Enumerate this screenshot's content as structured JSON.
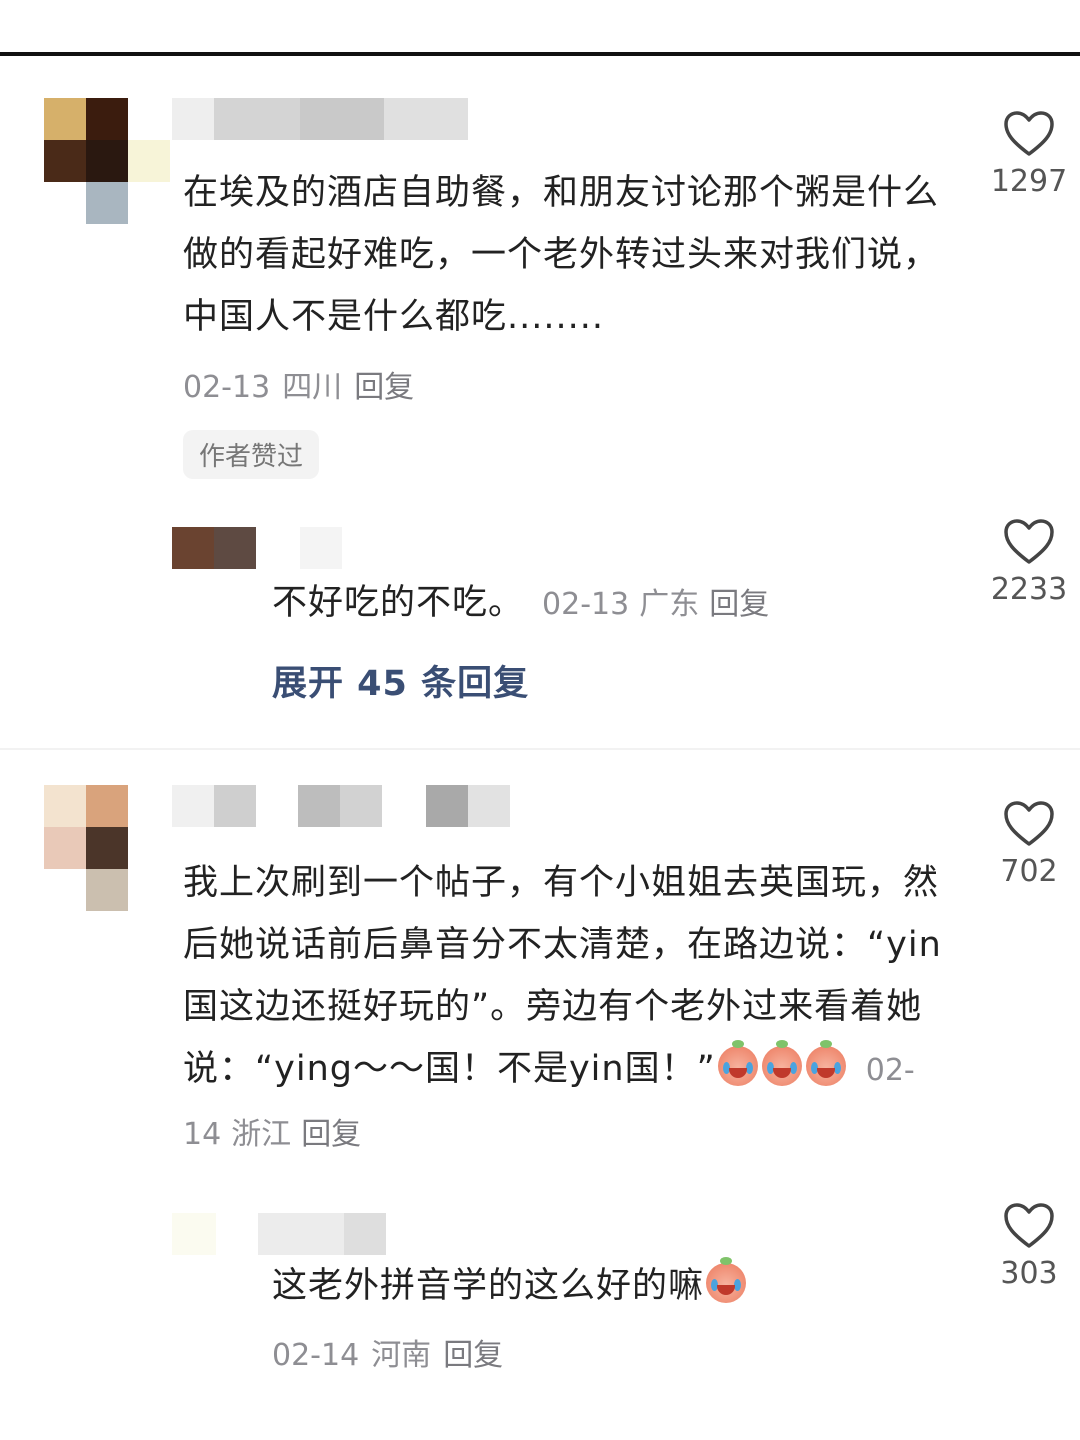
{
  "comments": [
    {
      "text": "在埃及的酒店自助餐，和朋友讨论那个粥是什么做的看起好难吃，一个老外转过头来对我们说，中国人不是什么都吃........",
      "date": "02-13",
      "location": "四川",
      "reply_label": "回复",
      "badge": "作者赞过",
      "likes": "1297",
      "replies": [
        {
          "text": "不好吃的不吃。",
          "date": "02-13",
          "location": "广东",
          "reply_label": "回复",
          "likes": "2233"
        }
      ],
      "expand_label": "展开 45 条回复"
    },
    {
      "text": "我上次刷到一个帖子，有个小姐姐去英国玩，然后她说话前后鼻音分不太清楚，在路边说：“yin国这边还挺好玩的”。旁边有个老外过来看着她说：“ying～～国！不是yin国！”",
      "date": "02-14",
      "location": "浙江",
      "reply_label": "回复",
      "likes": "702",
      "replies": [
        {
          "text": "这老外拼音学的这么好的嘛",
          "date": "02-14",
          "location": "河南",
          "reply_label": "回复",
          "likes": "303"
        }
      ]
    }
  ],
  "icons": {
    "like": "heart-outline-icon",
    "emoji": "crying-peach-emoji"
  },
  "colors": {
    "expand_link": "#3a4e74",
    "meta": "#8e8e93"
  }
}
